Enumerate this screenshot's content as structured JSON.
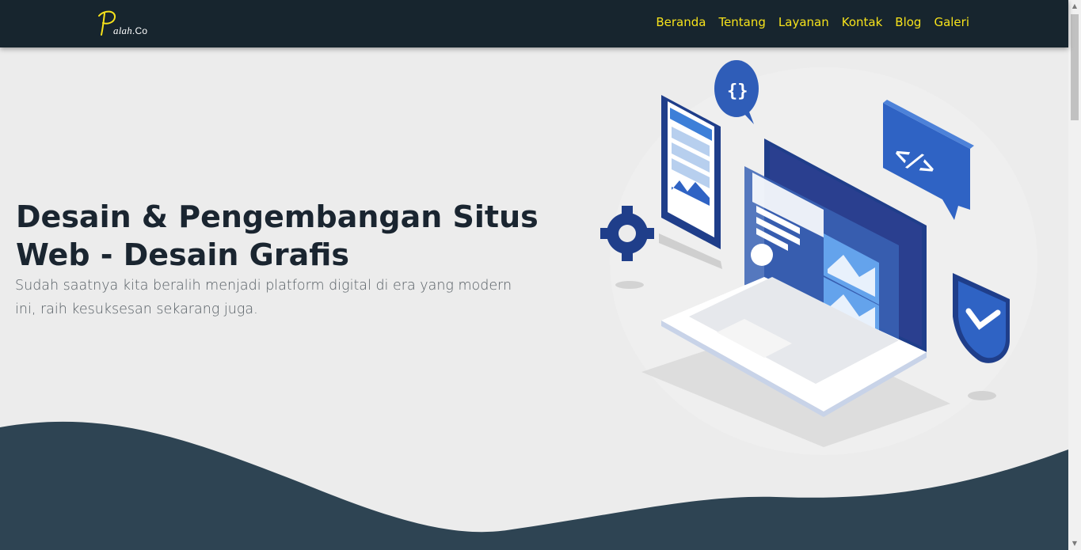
{
  "navbar": {
    "logo_initial": "P",
    "logo_rest": "alah",
    "logo_suffix": ".Co",
    "links": [
      "Beranda",
      "Tentang",
      "Layanan",
      "Kontak",
      "Blog",
      "Galeri"
    ]
  },
  "hero": {
    "title": "Desain & Pengembangan Situs Web - Desain Grafis",
    "subtitle": "Sudah saatnya kita beralih menjadi platform digital di era yang modern ini, raih kesuksesan sekarang juga."
  },
  "illustration": {
    "icons": [
      "code-braces-icon",
      "code-tag-icon",
      "gear-icon",
      "shield-check-icon",
      "phone-icon",
      "laptop-icon"
    ]
  },
  "colors": {
    "navbar_bg": "#17252e",
    "nav_link": "#f6e21b",
    "hero_bg": "#ececec",
    "wave": "#2e4453",
    "title": "#1a2530",
    "accent_blue": "#2f63c4"
  },
  "scrollbar": {
    "up_arrow": "▲",
    "down_arrow": "▼"
  }
}
